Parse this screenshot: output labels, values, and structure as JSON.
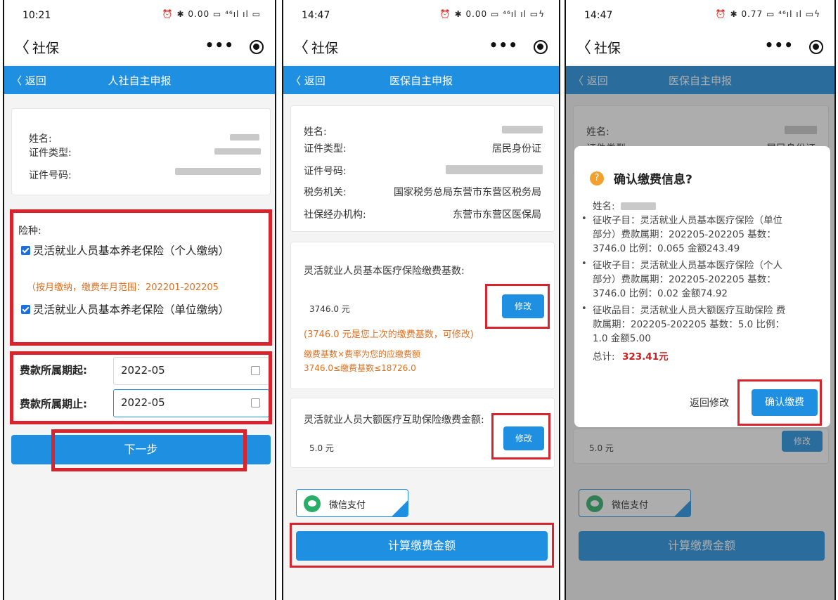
{
  "common": {
    "app_title": "社保",
    "back_chevron": "〈",
    "more_label": "•••",
    "return_label": "〈 返回"
  },
  "panel1": {
    "status_time": "10:21",
    "status_icons": "⏰ ✱ 0.00 ▭ ⁴⁶ıl ıl ▭",
    "page_title": "人社自主申报",
    "name_label": "姓名:",
    "id_type_label": "证件类型:",
    "id_no_label": "证件号码:",
    "insurance_label": "险种:",
    "insurance_items": [
      "灵活就业人员基本养老保险（个人缴纳）",
      "灵活就业人员基本养老保险（单位缴纳）"
    ],
    "monthly_note": "（按月缴纳，缴费年月范围：202201-202205",
    "period_start_label": "费款所属期起:",
    "period_start_value": "2022-05",
    "period_end_label": "费款所属期止:",
    "period_end_value": "2022-05",
    "next_button": "下一步"
  },
  "panel2": {
    "status_time": "14:47",
    "status_icons": "⏰ ✱ 0.00 ▭ ⁴⁶ıl ıl ▭ϟ",
    "page_title": "医保自主申报",
    "name_label": "姓名:",
    "id_type_label": "证件类型:",
    "id_type_value": "居民身份证",
    "id_no_label": "证件号码:",
    "tax_office_label": "税务机关:",
    "tax_office_value": "国家税务总局东营市东营区税务局",
    "agency_label": "社保经办机构:",
    "agency_value": "东营市东营区医保局",
    "base_title": "灵活就业人员基本医疗保险缴费基数:",
    "base_value": "3746.0 元",
    "modify_label": "修改",
    "base_note": "(3746.0 元是您上次的缴费基数，可修改)",
    "formula_1": "缴费基数×费率为您的应缴费额",
    "formula_2": "3746.0≤缴费基数≤18726.0",
    "mutual_title": "灵活就业人员大额医疗互助保险缴费金额:",
    "mutual_value": "5.0 元",
    "modify_label_2": "修改",
    "wechat_pay": "微信支付",
    "calc_button": "计算缴费金额"
  },
  "panel3": {
    "status_time": "14:47",
    "status_icons": "⏰ ✱ 0.77 ▭ ⁴⁶ıl ıl ▭ϟ",
    "page_title": "医保自主申报",
    "bg_name_label": "姓名:",
    "bg_id_label": "证件类型:",
    "bg_id_value": "居民身份证",
    "bg_mutual_value": "5.0 元",
    "bg_modify": "修改",
    "bg_wechat": "微信支付",
    "bg_calc": "计算缴费金额",
    "dialog": {
      "icon": "?",
      "title": "确认缴费信息?",
      "name_label": "姓名:",
      "items": [
        [
          "征收子目：灵活就业人员基本医疗保险（单位",
          "部分）费款属期：202205-202205 基数：",
          "3746.0 比例：0.065 金额243.49"
        ],
        [
          "征收子目：灵活就业人员基本医疗保险（个人",
          "部分）费款属期：202205-202205 基数：",
          "3746.0 比例：0.02 金额74.92"
        ],
        [
          "征收品目：灵活就业人员大额医疗互助保险 费",
          "款属期：202205-202205 基数：5.0 比例：",
          "1.0 金额5.00"
        ]
      ],
      "total_label": "总计:",
      "total_value": "323.41元",
      "back_label": "返回修改",
      "confirm_label": "确认缴费"
    }
  },
  "colors": {
    "primary_blue": "#1e8fe1",
    "highlight_red": "#d9232d",
    "note_orange": "#e07020",
    "wechat_green": "#2aae67",
    "total_red": "#c81e1e"
  }
}
